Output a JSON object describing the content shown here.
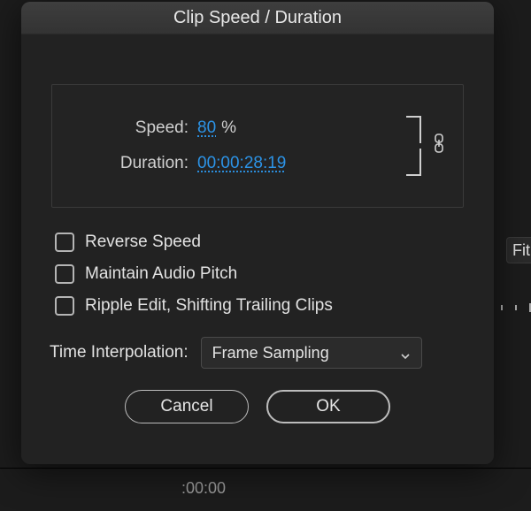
{
  "dialog": {
    "title": "Clip Speed / Duration",
    "speed": {
      "label": "Speed:",
      "value": "80",
      "suffix": "%"
    },
    "duration": {
      "label": "Duration:",
      "value": "00:00:28:19"
    },
    "linked": true,
    "options": {
      "reverseSpeed": {
        "label": "Reverse Speed",
        "checked": false
      },
      "maintainAudioPitch": {
        "label": "Maintain Audio Pitch",
        "checked": false
      },
      "rippleEdit": {
        "label": "Ripple Edit, Shifting Trailing Clips",
        "checked": false
      }
    },
    "timeInterpolation": {
      "label": "Time Interpolation:",
      "value": "Frame Sampling"
    },
    "buttons": {
      "cancel": "Cancel",
      "ok": "OK"
    }
  },
  "background": {
    "fitLabel": "Fit",
    "bottomTimecode": ":00:00"
  }
}
